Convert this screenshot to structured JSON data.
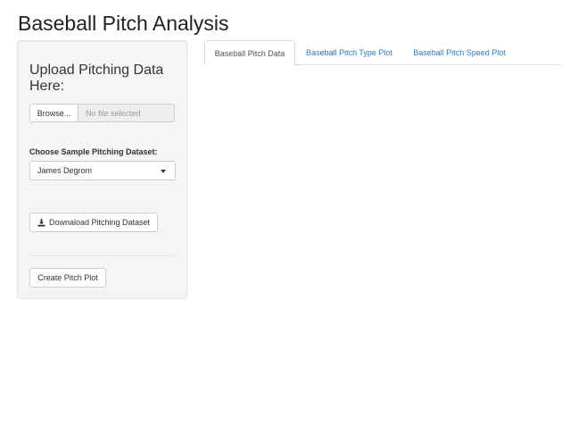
{
  "page": {
    "title": "Baseball Pitch Analysis"
  },
  "sidebar": {
    "upload_heading": "Upload Pitching Data Here:",
    "browse_label": "Browse...",
    "file_placeholder": "No file selected",
    "dataset_label": "Choose Sample Pitching Dataset:",
    "dataset_selected": "James Degrom",
    "download_label": "Downaload Pitching Dataset",
    "create_plot_label": "Create Pitch Plot"
  },
  "tabs": [
    {
      "label": "Baseball Pitch Data",
      "active": true
    },
    {
      "label": "Baseball Pitch Type Plot",
      "active": false
    },
    {
      "label": "Baseball Pitch Speed Plot",
      "active": false
    }
  ],
  "icons": {
    "download": "download-icon",
    "caret": "chevron-down-icon"
  },
  "colors": {
    "link": "#337ab7",
    "well_background": "#f5f5f5",
    "border": "#cccccc"
  }
}
